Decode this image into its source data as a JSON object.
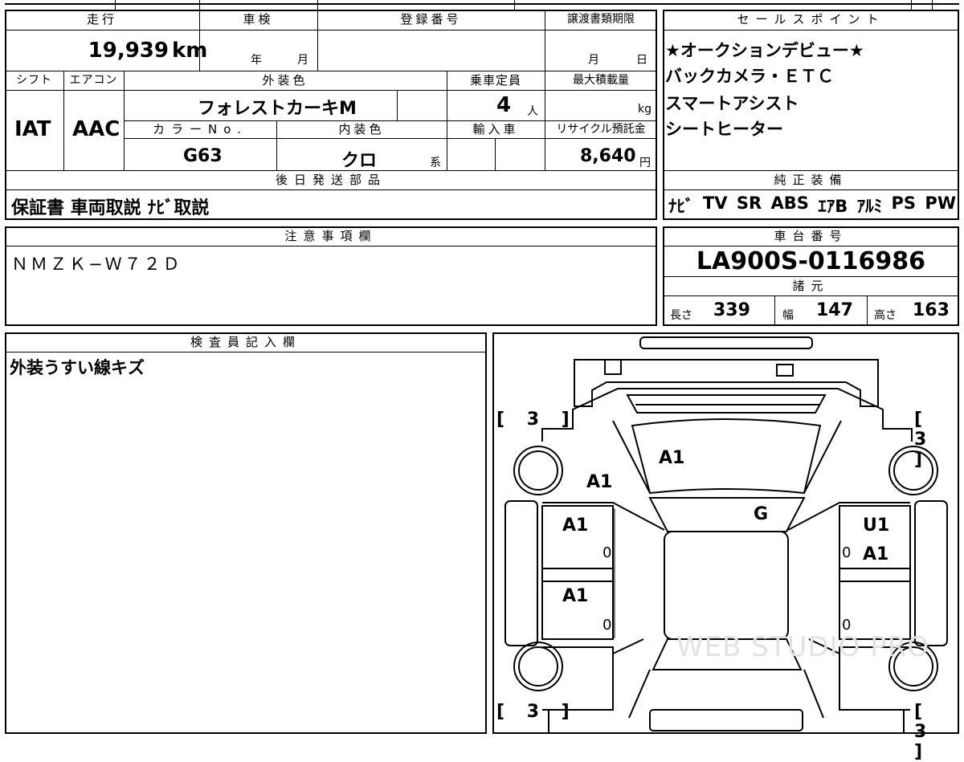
{
  "sheet": {
    "top_fragment": "",
    "mileage_header": "走行",
    "mileage_value": "19,939",
    "mileage_unit": "km",
    "shaken_header": "車検",
    "shaken_year_unit": "年",
    "shaken_month_unit": "月",
    "reg_header": "登録番号",
    "transfer_header": "譲渡書類期限",
    "transfer_month_unit": "月",
    "transfer_day_unit": "日",
    "shift_header": "シフト",
    "shift_value": "IAT",
    "ac_header": "エアコン",
    "ac_value": "AAC",
    "ext_color_header": "外装色",
    "ext_color_value": "フォレストカーキM",
    "capacity_header": "乗車定員",
    "capacity_value": "4",
    "capacity_unit": "人",
    "load_header": "最大積載量",
    "load_unit": "kg",
    "color_no_header": "カラーNo.",
    "color_no_value": "G63",
    "int_color_header": "内装色",
    "int_color_value": "クロ",
    "int_color_unit": "系",
    "import_header": "輸入車",
    "recycle_header": "リサイクル預託金",
    "recycle_value": "8,640",
    "recycle_unit": "円",
    "later_parts_header": "後日発送部品",
    "later_parts_value": "保証書 車両取説 ﾅﾋﾞ取説",
    "sales_header": "セールスポイント",
    "sales_points": [
      "★オークションデビュー★",
      "バックカメラ・ＥＴＣ",
      "スマートアシスト",
      "シートヒーター"
    ],
    "equip_header": "純正装備",
    "equip_items": [
      "ﾅﾋﾞ",
      "TV",
      "SR",
      "ABS",
      "ｴｱB",
      "ｱﾙﾐ",
      "PS",
      "PW"
    ],
    "notes_header": "注意事項欄",
    "notes_value": "ＮＭＺＫ−Ｗ７２Ｄ",
    "chassis_header": "車台番号",
    "chassis_value": "LA900S-0116986",
    "spec_header": "諸元",
    "length_label": "長さ",
    "length_value": "339",
    "width_label": "幅",
    "width_value": "147",
    "height_label": "高さ",
    "height_value": "163",
    "inspector_header": "検査員記入欄",
    "inspector_value": "外装うすい線キズ",
    "watermark": "WEB STUDIO PRO"
  },
  "diagram": {
    "tire_tl": "[ 3 ]",
    "tire_tr": "[ 3 ]",
    "tire_bl": "[ 3 ]",
    "tire_br": "[ 3 ]",
    "dmg_windshield": "A1",
    "dmg_front_left": "A1",
    "dmg_front_door_left": "A1",
    "dmg_rear_door_left": "A1",
    "dmg_roof_glass": "G",
    "dmg_front_door_right_1": "U1",
    "dmg_front_door_right_2": "A1",
    "zero": "0"
  }
}
